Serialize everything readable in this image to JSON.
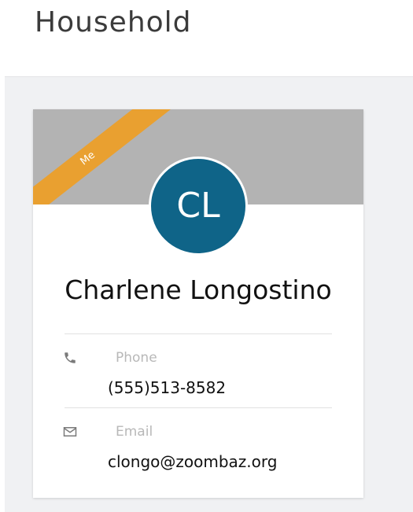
{
  "page": {
    "title": "Household"
  },
  "member_card": {
    "ribbon_label": "Me",
    "avatar_initials": "CL",
    "name": "Charlene Longostino",
    "phone": {
      "icon": "phone-icon",
      "label": "Phone",
      "value": "(555)513-8582"
    },
    "email": {
      "icon": "envelope-icon",
      "label": "Email",
      "value": "clongo@zoombaz.org"
    }
  },
  "colors": {
    "banner": "#b3b3b3",
    "ribbon": "#e9a030",
    "avatar": "#0f6488",
    "panel": "#f0f1f3"
  }
}
